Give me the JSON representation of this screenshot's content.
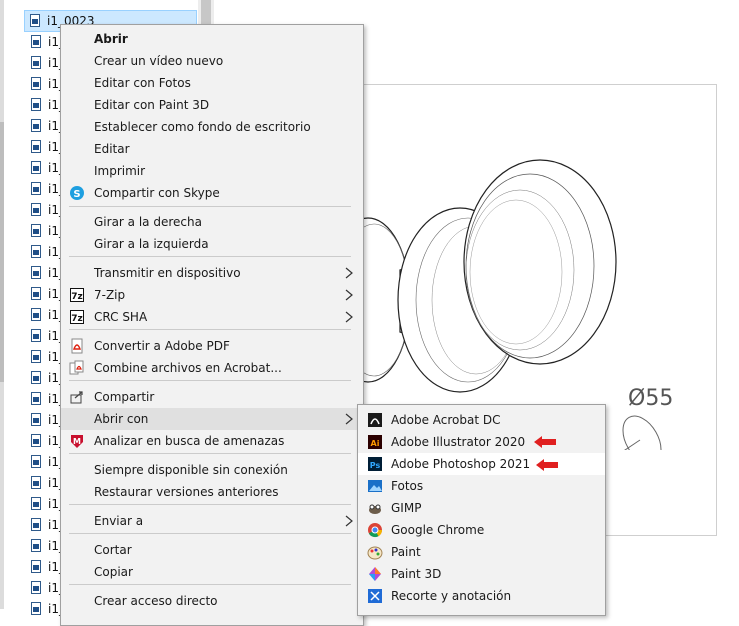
{
  "file_list": {
    "items": [
      {
        "name": "i1_0023",
        "selected": true
      },
      {
        "name": "i1_"
      },
      {
        "name": "i1_"
      },
      {
        "name": "i1_"
      },
      {
        "name": "i1_"
      },
      {
        "name": "i1_"
      },
      {
        "name": "i1_"
      },
      {
        "name": "i1_"
      },
      {
        "name": "i1_"
      },
      {
        "name": "i1_"
      },
      {
        "name": "i1_"
      },
      {
        "name": "i1_"
      },
      {
        "name": "i1_"
      },
      {
        "name": "i1_"
      },
      {
        "name": "i1_"
      },
      {
        "name": "i1_"
      },
      {
        "name": "i1_"
      },
      {
        "name": "i1_"
      },
      {
        "name": "i1_"
      },
      {
        "name": "i1_"
      },
      {
        "name": "i1_"
      },
      {
        "name": "i1_"
      },
      {
        "name": "i1_"
      },
      {
        "name": "i1_"
      },
      {
        "name": "i1_"
      },
      {
        "name": "i1_"
      },
      {
        "name": "i1_"
      },
      {
        "name": "i1_"
      },
      {
        "name": "i1_"
      }
    ]
  },
  "preview": {
    "dimension_label": "Ø55"
  },
  "context_menu": {
    "items": [
      {
        "label": "Abrir",
        "bold": true
      },
      {
        "label": "Crear un vídeo nuevo"
      },
      {
        "label": "Editar con Fotos"
      },
      {
        "label": "Editar con Paint 3D"
      },
      {
        "label": "Establecer como fondo de escritorio"
      },
      {
        "label": "Editar"
      },
      {
        "label": "Imprimir"
      },
      {
        "label": "Compartir con Skype",
        "icon": "skype-icon"
      },
      {
        "label": "Girar a la derecha"
      },
      {
        "label": "Girar a la izquierda"
      },
      {
        "label": "Transmitir en dispositivo",
        "submenu": true
      },
      {
        "label": "7-Zip",
        "icon": "7zip-icon",
        "submenu": true
      },
      {
        "label": "CRC SHA",
        "icon": "7zip-icon",
        "submenu": true
      },
      {
        "label": "Convertir a Adobe PDF",
        "icon": "adobe-pdf-icon"
      },
      {
        "label": "Combine archivos en Acrobat...",
        "icon": "acrobat-combine-icon"
      },
      {
        "label": "Compartir",
        "icon": "share-icon"
      },
      {
        "label": "Abrir con",
        "submenu": true,
        "hover": true
      },
      {
        "label": "Analizar en busca de amenazas",
        "icon": "mcafee-icon"
      },
      {
        "label": "Siempre disponible sin conexión"
      },
      {
        "label": "Restaurar versiones anteriores"
      },
      {
        "label": "Enviar a",
        "submenu": true
      },
      {
        "label": "Cortar"
      },
      {
        "label": "Copiar"
      },
      {
        "label": "Crear acceso directo"
      }
    ]
  },
  "open_with_submenu": {
    "items": [
      {
        "label": "Adobe Acrobat DC",
        "icon": "acrobat-icon"
      },
      {
        "label": "Adobe Illustrator 2020",
        "icon": "illustrator-icon",
        "annotated": true
      },
      {
        "label": "Adobe Photoshop 2021",
        "icon": "photoshop-icon",
        "annotated": true,
        "hover": true
      },
      {
        "label": "Fotos",
        "icon": "photos-icon"
      },
      {
        "label": "GIMP",
        "icon": "gimp-icon"
      },
      {
        "label": "Google Chrome",
        "icon": "chrome-icon"
      },
      {
        "label": "Paint",
        "icon": "paint-icon"
      },
      {
        "label": "Paint 3D",
        "icon": "paint3d-icon"
      },
      {
        "label": "Recorte y anotación",
        "icon": "snip-icon"
      }
    ]
  },
  "colors": {
    "selection": "#cce8ff",
    "annotation_arrow": "#e02020",
    "menu_bg": "#f2f2f2"
  }
}
